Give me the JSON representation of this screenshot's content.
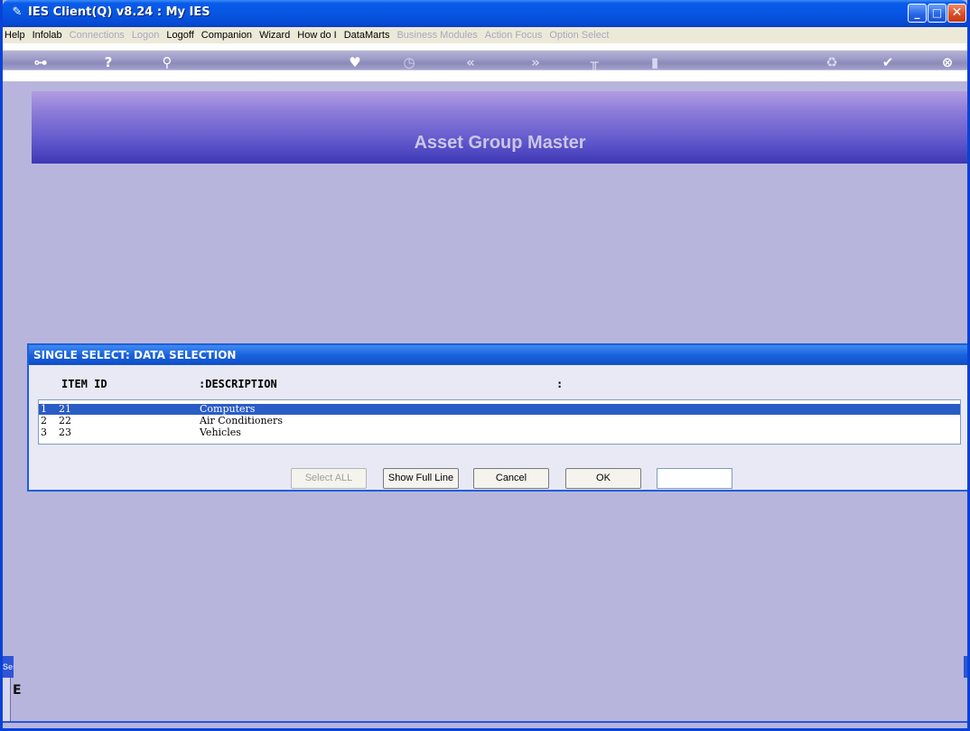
{
  "window": {
    "title": "IES Client(Q) v8.24 : My IES"
  },
  "menu": [
    {
      "label": "Help",
      "enabled": true
    },
    {
      "label": "Infolab",
      "enabled": true
    },
    {
      "label": "Connections",
      "enabled": false
    },
    {
      "label": "Logon",
      "enabled": false
    },
    {
      "label": "Logoff",
      "enabled": true
    },
    {
      "label": "Companion",
      "enabled": true
    },
    {
      "label": "Wizard",
      "enabled": true
    },
    {
      "label": "How do I",
      "enabled": true
    },
    {
      "label": "DataMarts",
      "enabled": true
    },
    {
      "label": "Business Modules",
      "enabled": false
    },
    {
      "label": "Action Focus",
      "enabled": false
    },
    {
      "label": "Option Select",
      "enabled": false
    }
  ],
  "toolbar_icons": [
    "key-icon",
    "help-icon",
    "search-icon",
    "heart-icon",
    "clock-icon",
    "rewind-icon",
    "fast-forward-icon",
    "tools-icon",
    "pages-icon",
    "recycle-icon",
    "check-icon",
    "close-icon"
  ],
  "banner": {
    "title": "Asset Group Master"
  },
  "dialog": {
    "title": "SINGLE SELECT: DATA SELECTION",
    "columns": {
      "item_id": "ITEM ID",
      "description": ":DESCRIPTION",
      "extra": ":"
    },
    "rows": [
      {
        "num": "1",
        "id": "21",
        "description": "Computers",
        "selected": true
      },
      {
        "num": "2",
        "id": "22",
        "description": "Air Conditioners",
        "selected": false
      },
      {
        "num": "3",
        "id": "23",
        "description": "Vehicles",
        "selected": false
      }
    ],
    "buttons": {
      "select_all": "Select ALL",
      "show_full_line": "Show Full Line",
      "cancel": "Cancel",
      "ok": "OK"
    },
    "input_value": ""
  },
  "side": {
    "tab_label": "Ses",
    "glyph": "E"
  },
  "colors": {
    "title_bar": "#0756e3",
    "background": "#b7b5dc",
    "selection": "#2a5cc6",
    "banner": "#5f57cc"
  }
}
